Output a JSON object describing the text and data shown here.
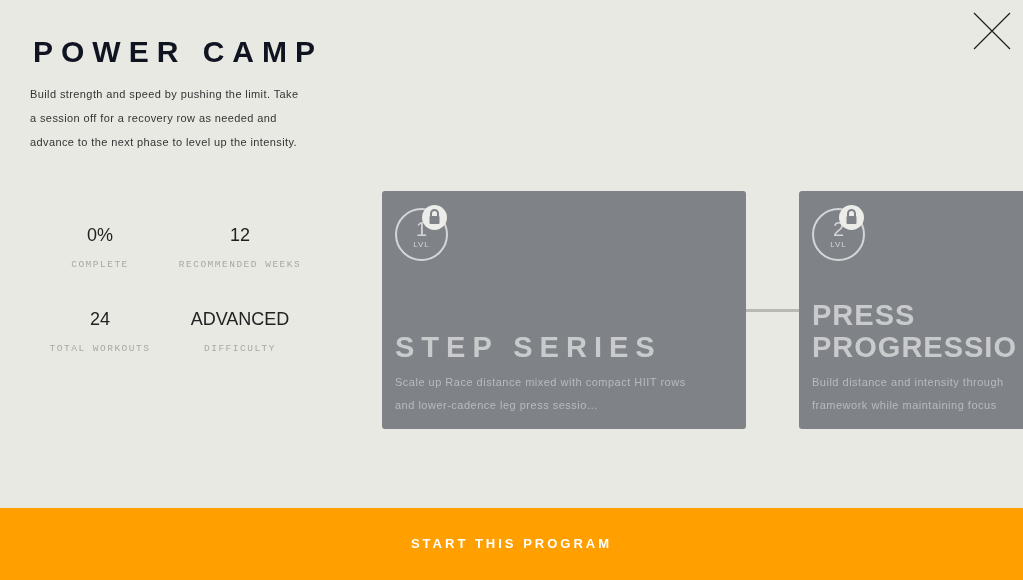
{
  "program": {
    "title": "POWER CAMP",
    "description": "Build strength and speed by pushing the limit. Take a session off for a recovery row as needed and advance to the next phase to level up the intensity."
  },
  "stats": [
    {
      "value": "0%",
      "label": "COMPLETE"
    },
    {
      "value": "12",
      "label": "RECOMMENDED WEEKS"
    },
    {
      "value": "24",
      "label": "TOTAL WORKOUTS"
    },
    {
      "value": "ADVANCED",
      "label": "DIFFICULTY"
    }
  ],
  "levels": [
    {
      "number": "1",
      "level_label": "LVL",
      "locked": true,
      "title": "STEP SERIES",
      "description": "Scale up Race distance mixed with compact HIIT rows and lower-cadence leg press sessio…"
    },
    {
      "number": "2",
      "level_label": "LVL",
      "locked": true,
      "title": "PRESS PROGRESSIO",
      "description": "Build distance and intensity through framework while maintaining focus"
    }
  ],
  "start_button": {
    "label": "START THIS PROGRAM"
  }
}
